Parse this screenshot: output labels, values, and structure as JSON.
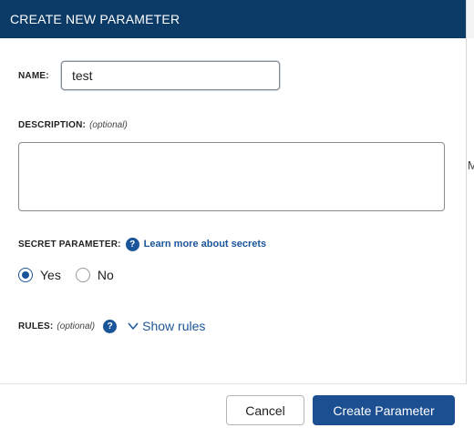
{
  "modal": {
    "title": "CREATE NEW PARAMETER"
  },
  "name_field": {
    "label": "NAME:",
    "value": "test",
    "placeholder": ""
  },
  "description_field": {
    "label": "DESCRIPTION:",
    "optional": "(optional)",
    "value": "",
    "placeholder": ""
  },
  "secret": {
    "label": "SECRET PARAMETER:",
    "help_icon": "?",
    "link_text": "Learn more about secrets",
    "options": [
      {
        "label": "Yes",
        "checked": true
      },
      {
        "label": "No",
        "checked": false
      }
    ]
  },
  "rules": {
    "label": "RULES:",
    "optional": "(optional)",
    "help_icon": "?",
    "toggle_label": "Show rules"
  },
  "footer": {
    "cancel_label": "Cancel",
    "create_label": "Create Parameter"
  },
  "background": {
    "peek_text": "M"
  },
  "colors": {
    "header_bg": "#0b3a66",
    "accent": "#1b5599",
    "primary_button": "#1b4f91"
  },
  "icons": {
    "help": "help-circle-icon",
    "chevron": "chevron-down-icon"
  }
}
